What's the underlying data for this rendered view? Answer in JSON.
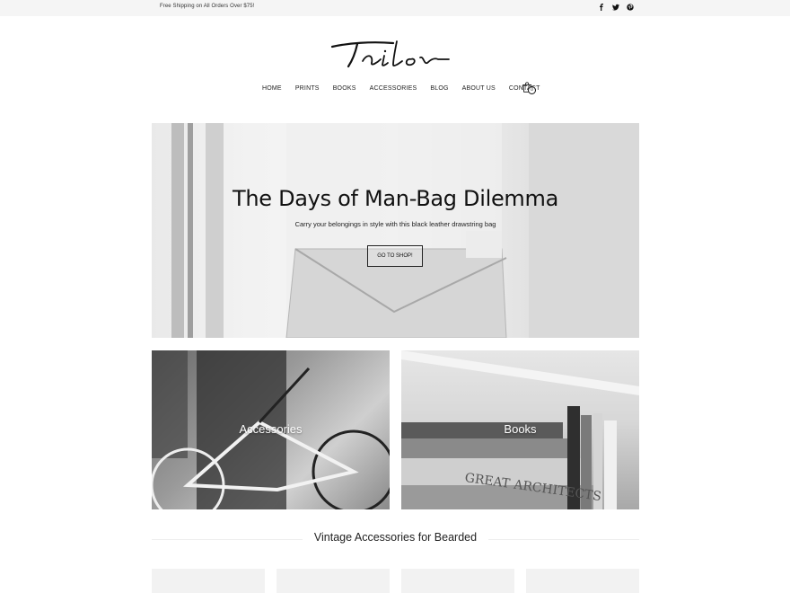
{
  "topbar": {
    "promo": "Free Shipping on All Orders Over $75!",
    "social": [
      "facebook-icon",
      "twitter-icon",
      "pinterest-icon"
    ]
  },
  "brand": {
    "logo_text": "Tailor"
  },
  "nav": {
    "items": [
      {
        "label": "HOME"
      },
      {
        "label": "PRINTS"
      },
      {
        "label": "BOOKS"
      },
      {
        "label": "ACCESSORIES"
      },
      {
        "label": "BLOG"
      },
      {
        "label": "ABOUT US"
      },
      {
        "label": "CONTACT"
      }
    ],
    "cart_count": "0"
  },
  "hero": {
    "title": "The Days of Man-Bag Dilemma",
    "subtitle": "Carry your belongings in style with this black leather drawstring bag",
    "button": "GO TO SHOP!"
  },
  "categories": [
    {
      "label": "Accessories"
    },
    {
      "label": "Books"
    }
  ],
  "section": {
    "title": "Vintage Accessories for Bearded"
  },
  "books_spine_text": "GREAT ARCHITECTS"
}
